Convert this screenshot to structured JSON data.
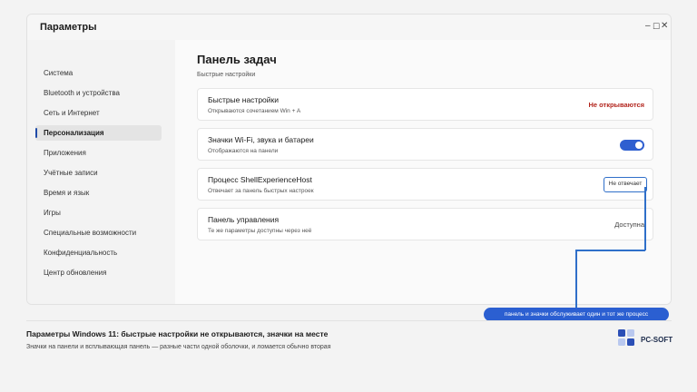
{
  "window": {
    "title": "Параметры",
    "controls": {
      "minimize": "–",
      "maximize": "☐",
      "close": "✕"
    }
  },
  "sidebar": {
    "items": [
      {
        "label": "Система"
      },
      {
        "label": "Bluetooth и устройства"
      },
      {
        "label": "Сеть и Интернет"
      },
      {
        "label": "Персонализация",
        "active": true
      },
      {
        "label": "Приложения"
      },
      {
        "label": "Учётные записи"
      },
      {
        "label": "Время и язык"
      },
      {
        "label": "Игры"
      },
      {
        "label": "Специальные возможности"
      },
      {
        "label": "Конфиденциальность"
      },
      {
        "label": "Центр обновления"
      }
    ]
  },
  "main": {
    "title": "Панель задач",
    "subtitle": "Быстрые настройки",
    "cards": [
      {
        "title": "Быстрые настройки",
        "description": "Открываются сочетанием Win + A",
        "status": "Не открываются"
      },
      {
        "title": "Значки Wi-Fi, звука и батареи",
        "description": "Отображаются на панели",
        "toggle": true
      },
      {
        "title": "Процесс ShellExperienceHost",
        "description": "Отвечает за панель быстрых настроек",
        "status": "Не отвечает"
      },
      {
        "title": "Панель управления",
        "description": "Те же параметры доступны через неё",
        "status": "Доступна"
      }
    ]
  },
  "callout": {
    "text": "панель и значки обслуживает один и тот же процесс"
  },
  "caption": {
    "title": "Параметры Windows 11: быстрые настройки не открываются, значки на месте",
    "subtitle": "Значки на панели и всплывающая панель — разные части одной оболочки, и ломается обычно вторая"
  },
  "logo": {
    "text": "PC-SOFT"
  },
  "colors": {
    "accent": "#2f5fd0",
    "error": "#b3261e",
    "callout": "#2b5fd1",
    "logo_light": "#b9c8ef",
    "logo_dark": "#2b4fb6"
  }
}
